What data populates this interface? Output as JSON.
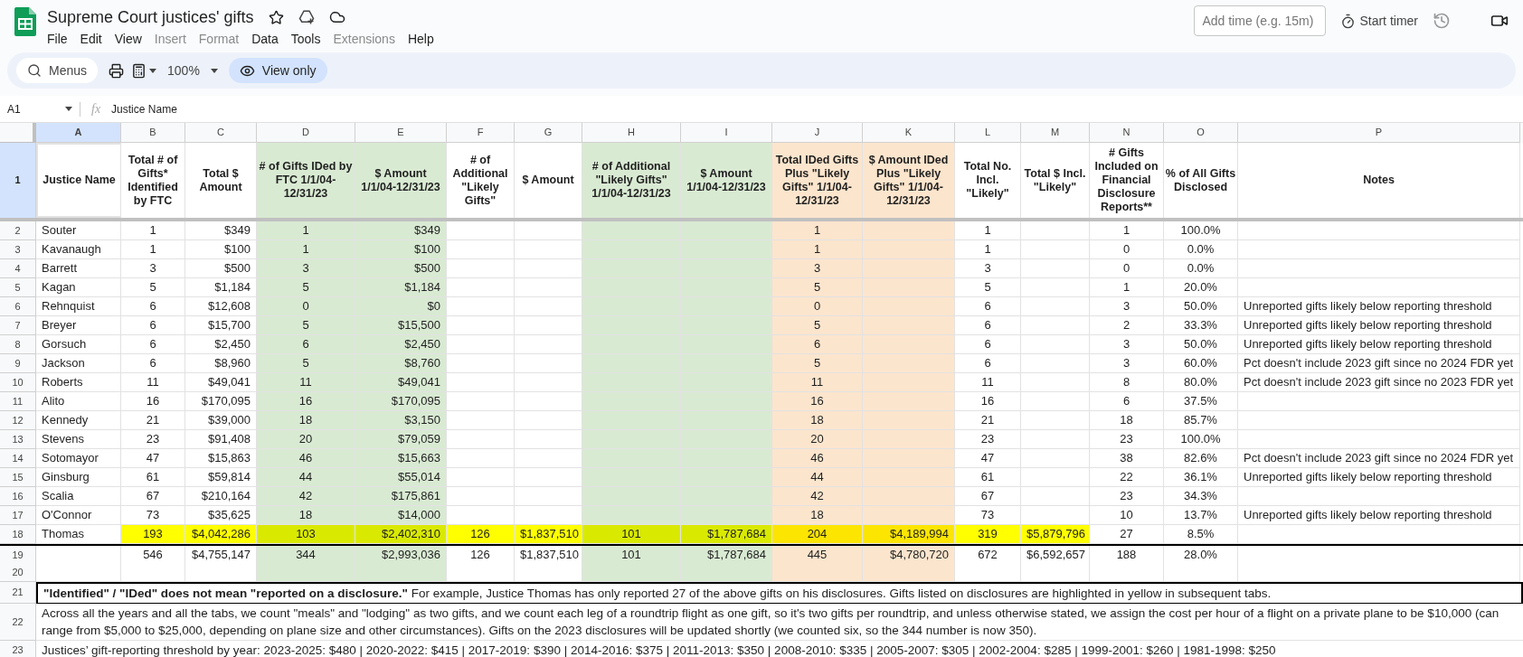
{
  "window": {
    "title": "Supreme Court justices' gifts"
  },
  "menu": [
    {
      "label": "File",
      "disabled": false
    },
    {
      "label": "Edit",
      "disabled": false
    },
    {
      "label": "View",
      "disabled": false
    },
    {
      "label": "Insert",
      "disabled": true
    },
    {
      "label": "Format",
      "disabled": true
    },
    {
      "label": "Data",
      "disabled": false
    },
    {
      "label": "Tools",
      "disabled": false
    },
    {
      "label": "Extensions",
      "disabled": true
    },
    {
      "label": "Help",
      "disabled": false
    }
  ],
  "timer": {
    "placeholder": "Add time (e.g. 15m)",
    "button": "Start timer"
  },
  "toolbar": {
    "search": "Menus",
    "zoom": "100%",
    "mode": "View only"
  },
  "formula_bar": {
    "cell": "A1",
    "fx": "fx",
    "value": "Justice Name"
  },
  "heading_row": "1",
  "columns": [
    {
      "letter": "A",
      "heading": "Justice Name",
      "selected": true
    },
    {
      "letter": "B",
      "heading": "Total # of Gifts* Identified by FTC",
      "selected": false
    },
    {
      "letter": "C",
      "heading": "Total $ Amount",
      "selected": false
    },
    {
      "letter": "D",
      "heading": "# of Gifts IDed by FTC 1/1/04-12/31/23",
      "selected": false,
      "color": "#d9ead3"
    },
    {
      "letter": "E",
      "heading": "$ Amount 1/1/04-12/31/23",
      "selected": false,
      "color": "#d9ead3"
    },
    {
      "letter": "F",
      "heading": "# of Additional \"Likely Gifts\"",
      "selected": false
    },
    {
      "letter": "G",
      "heading": "$ Amount",
      "selected": false
    },
    {
      "letter": "H",
      "heading": "# of Additional \"Likely Gifts\" 1/1/04-12/31/23",
      "selected": false,
      "color": "#d9ead3"
    },
    {
      "letter": "I",
      "heading": "$ Amount 1/1/04-12/31/23",
      "selected": false,
      "color": "#d9ead3"
    },
    {
      "letter": "J",
      "heading": "Total IDed Gifts Plus \"Likely Gifts\" 1/1/04-12/31/23",
      "selected": false,
      "color": "#fce5cd"
    },
    {
      "letter": "K",
      "heading": "$ Amount IDed Plus \"Likely Gifts\" 1/1/04-12/31/23",
      "selected": false,
      "color": "#fce5cd"
    },
    {
      "letter": "L",
      "heading": "Total No. Incl. \"Likely\"",
      "selected": false
    },
    {
      "letter": "M",
      "heading": "Total $ Incl. \"Likely\"",
      "selected": false
    },
    {
      "letter": "N",
      "heading": "# Gifts Included on Financial Disclosure Reports**",
      "selected": false
    },
    {
      "letter": "O",
      "heading": "% of All Gifts Disclosed",
      "selected": false
    },
    {
      "letter": "P",
      "heading": "Notes",
      "selected": false
    }
  ],
  "rows": [
    {
      "number": "2",
      "cells": [
        "Souter",
        "1",
        "$349",
        "1",
        "$349",
        null,
        null,
        null,
        null,
        "1",
        null,
        "1",
        null,
        "1",
        "100.0%",
        null
      ]
    },
    {
      "number": "3",
      "cells": [
        "Kavanaugh",
        "1",
        "$100",
        "1",
        "$100",
        null,
        null,
        null,
        null,
        "1",
        null,
        "1",
        null,
        "0",
        "0.0%",
        null
      ]
    },
    {
      "number": "4",
      "cells": [
        "Barrett",
        "3",
        "$500",
        "3",
        "$500",
        null,
        null,
        null,
        null,
        "3",
        null,
        "3",
        null,
        "0",
        "0.0%",
        null
      ]
    },
    {
      "number": "5",
      "cells": [
        "Kagan",
        "5",
        "$1,184",
        "5",
        "$1,184",
        null,
        null,
        null,
        null,
        "5",
        null,
        "5",
        null,
        "1",
        "20.0%",
        null
      ]
    },
    {
      "number": "6",
      "cells": [
        "Rehnquist",
        "6",
        "$12,608",
        "0",
        "$0",
        null,
        null,
        null,
        null,
        "0",
        null,
        "6",
        null,
        "3",
        "50.0%",
        "Unreported gifts likely below reporting threshold"
      ]
    },
    {
      "number": "7",
      "cells": [
        "Breyer",
        "6",
        "$15,700",
        "5",
        "$15,500",
        null,
        null,
        null,
        null,
        "5",
        null,
        "6",
        null,
        "2",
        "33.3%",
        "Unreported gifts likely below reporting threshold"
      ]
    },
    {
      "number": "8",
      "cells": [
        "Gorsuch",
        "6",
        "$2,450",
        "6",
        "$2,450",
        null,
        null,
        null,
        null,
        "6",
        null,
        "6",
        null,
        "3",
        "50.0%",
        "Unreported gifts likely below reporting threshold"
      ]
    },
    {
      "number": "9",
      "cells": [
        "Jackson",
        "6",
        "$8,960",
        "5",
        "$8,760",
        null,
        null,
        null,
        null,
        "5",
        null,
        "6",
        null,
        "3",
        "60.0%",
        "Pct doesn't include 2023 gift since no 2024 FDR yet"
      ]
    },
    {
      "number": "10",
      "cells": [
        "Roberts",
        "11",
        "$49,041",
        "11",
        "$49,041",
        null,
        null,
        null,
        null,
        "11",
        null,
        "11",
        null,
        "8",
        "80.0%",
        "Pct doesn't include 2023 gift since no 2023 FDR yet"
      ]
    },
    {
      "number": "11",
      "cells": [
        "Alito",
        "16",
        "$170,095",
        "16",
        "$170,095",
        null,
        null,
        null,
        null,
        "16",
        null,
        "16",
        null,
        "6",
        "37.5%",
        null
      ]
    },
    {
      "number": "12",
      "cells": [
        "Kennedy",
        "21",
        "$39,000",
        "18",
        "$3,150",
        null,
        null,
        null,
        null,
        "18",
        null,
        "21",
        null,
        "18",
        "85.7%",
        null
      ]
    },
    {
      "number": "13",
      "cells": [
        "Stevens",
        "23",
        "$91,408",
        "20",
        "$79,059",
        null,
        null,
        null,
        null,
        "20",
        null,
        "23",
        null,
        "23",
        "100.0%",
        null
      ]
    },
    {
      "number": "14",
      "cells": [
        "Sotomayor",
        "47",
        "$15,863",
        "46",
        "$15,663",
        null,
        null,
        null,
        null,
        "46",
        null,
        "47",
        null,
        "38",
        "82.6%",
        "Pct doesn't include 2023 gift since no 2024 FDR yet"
      ]
    },
    {
      "number": "15",
      "cells": [
        "Ginsburg",
        "61",
        "$59,814",
        "44",
        "$55,014",
        null,
        null,
        null,
        null,
        "44",
        null,
        "61",
        null,
        "22",
        "36.1%",
        "Unreported gifts likely below reporting threshold"
      ]
    },
    {
      "number": "16",
      "cells": [
        "Scalia",
        "67",
        "$210,164",
        "42",
        "$175,861",
        null,
        null,
        null,
        null,
        "42",
        null,
        "67",
        null,
        "23",
        "34.3%",
        null
      ]
    },
    {
      "number": "17",
      "cells": [
        "O'Connor",
        "73",
        "$35,625",
        "18",
        "$14,000",
        null,
        null,
        null,
        null,
        "18",
        null,
        "73",
        null,
        "10",
        "13.7%",
        "Unreported gifts likely below reporting threshold"
      ]
    },
    {
      "number": "18",
      "color": "#ffff00",
      "highlighted": [
        false,
        true,
        true,
        true,
        true,
        true,
        true,
        true,
        true,
        true,
        true,
        true,
        true,
        false,
        false,
        false
      ],
      "cells": [
        "Thomas",
        "193",
        "$4,042,286",
        "103",
        "$2,402,310",
        "126",
        "$1,837,510",
        "101",
        "$1,787,684",
        "204",
        "$4,189,994",
        "319",
        "$5,879,796",
        "27",
        "8.5%",
        null
      ]
    },
    {
      "number": "19",
      "cells": [
        null,
        "546",
        "$4,755,147",
        "344",
        "$2,993,036",
        "126",
        "$1,837,510",
        "101",
        "$1,787,684",
        "445",
        "$4,780,720",
        "672",
        "$6,592,657",
        "188",
        "28.0%",
        null
      ]
    },
    {
      "number": "20",
      "cells": [
        null,
        null,
        null,
        null,
        null,
        null,
        null,
        null,
        null,
        null,
        null,
        null,
        null,
        null,
        null,
        null
      ]
    }
  ],
  "notes": [
    {
      "number": "21",
      "text": "**\"Identified\" / \"IDed\" does not mean \"reported on a disclosure.\"** For example, Justice Thomas has only reported 27 of the above gifts on his disclosures. Gifts listed on disclosures are highlighted in yellow in subsequent tabs."
    },
    {
      "number": "22",
      "text": "Across all the years and all the tabs, we count \"meals\" and \"lodging\" as two gifts, and we count each leg of a roundtrip flight as one gift, so it's two gifts per roundtrip, and unless otherwise stated, we assign the cost per hour of a flight on a private plane to be $10,000 (can range from $5,000 to $25,000, depending on plane size and other circumstances). Gifts on the 2023 disclosures will be updated shortly (we counted six, so the 344 number is now 350)."
    },
    {
      "number": "23",
      "text": "Justices’ gift-reporting threshold by year: 2023-2025: $480 | 2020-2022: $415 | 2017-2019: $390 | 2014-2016: $375 | 2011-2013: $350 | 2008-2010: $335 | 2005-2007: $305 | 2002-2004: $285 | 1999-2001: $260 | 1981-1998: $250"
    }
  ]
}
